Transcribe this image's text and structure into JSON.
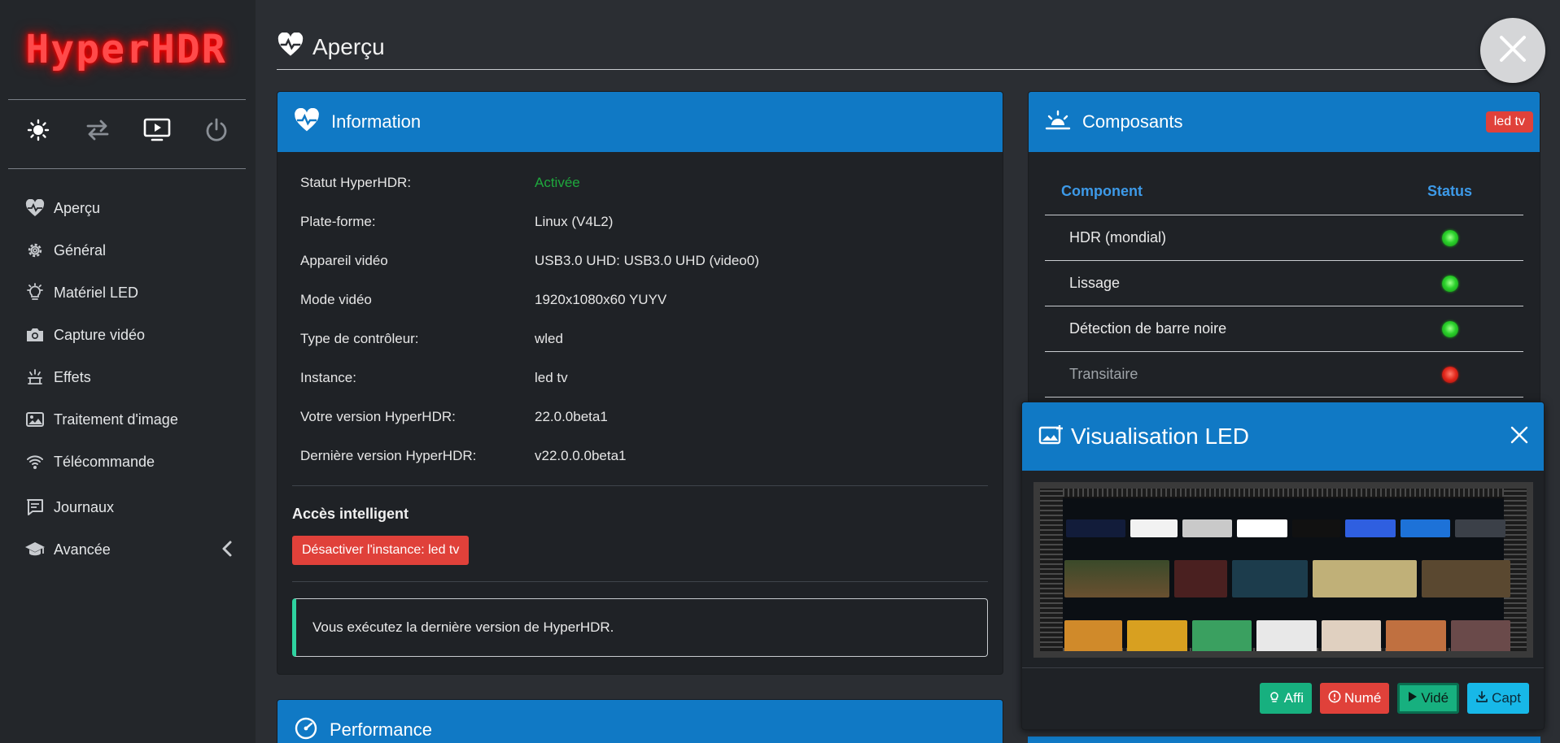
{
  "app": {
    "logo": "HyperHDR"
  },
  "sidebar": {
    "quick_icons": [
      "sun-icon",
      "arrows-swap-icon",
      "screen-play-icon",
      "power-icon"
    ],
    "items": [
      {
        "label": "Aperçu",
        "icon": "heartbeat-icon"
      },
      {
        "label": "Général",
        "icon": "gear-icon"
      },
      {
        "label": "Matériel LED",
        "icon": "lightbulb-icon"
      },
      {
        "label": "Capture vidéo",
        "icon": "camera-icon"
      },
      {
        "label": "Effets",
        "icon": "effects-icon"
      },
      {
        "label": "Traitement d'image",
        "icon": "image-icon"
      },
      {
        "label": "Télécommande",
        "icon": "wifi-remote-icon"
      },
      {
        "label": "Journaux",
        "icon": "log-icon"
      },
      {
        "label": "Avancée",
        "icon": "graduation-cap-icon"
      }
    ]
  },
  "page": {
    "title": "Aperçu"
  },
  "info": {
    "title": "Information",
    "rows": [
      {
        "k": "Statut HyperHDR:",
        "v": "Activée"
      },
      {
        "k": "Plate-forme:",
        "v": "Linux (V4L2)"
      },
      {
        "k": "Appareil vidéo",
        "v": "USB3.0 UHD: USB3.0 UHD (video0)"
      },
      {
        "k": "Mode vidéo",
        "v": "1920x1080x60 YUYV"
      },
      {
        "k": "Type de contrôleur:",
        "v": "wled"
      },
      {
        "k": "Instance:",
        "v": "led tv"
      },
      {
        "k": "Votre version HyperHDR:",
        "v": "22.0.0beta1"
      },
      {
        "k": "Dernière version HyperHDR:",
        "v": "v22.0.0.0beta1"
      }
    ],
    "smart_title": "Accès intelligent",
    "disable_button": "Désactiver l'instance: led tv",
    "callout": "Vous exécutez la dernière version de HyperHDR."
  },
  "performance": {
    "title": "Performance"
  },
  "components": {
    "title": "Composants",
    "badge": "led tv",
    "col_component": "Component",
    "col_status": "Status",
    "rows": [
      {
        "name": "HDR (mondial)",
        "status": "on"
      },
      {
        "name": "Lissage",
        "status": "on"
      },
      {
        "name": "Détection de barre noire",
        "status": "on"
      },
      {
        "name": "Transitaire",
        "status": "off"
      }
    ]
  },
  "led_viz": {
    "title": "Visualisation LED",
    "buttons": [
      "Affi",
      "Numé",
      "Vidé",
      "Capt"
    ]
  },
  "colors": {
    "accent": "#1079c5",
    "danger": "#e0413a",
    "success": "#17b07f",
    "info": "#17b8e8"
  }
}
